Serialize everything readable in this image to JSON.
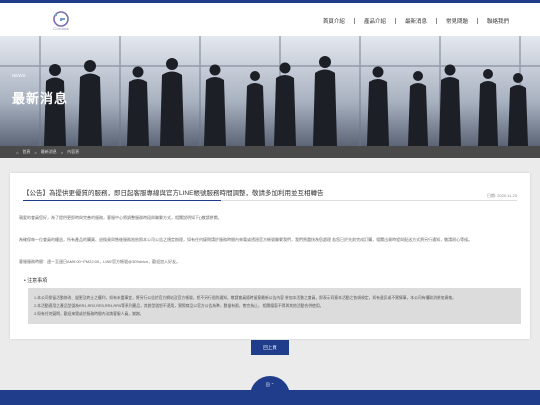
{
  "brand": {
    "logo_text": "Cordina"
  },
  "nav": {
    "items": [
      {
        "label": "首頁介紹"
      },
      {
        "label": "產品介紹"
      },
      {
        "label": "最新消息"
      },
      {
        "label": "常見問題"
      },
      {
        "label": "聯絡我們"
      }
    ]
  },
  "banner": {
    "subtitle": "NEWS",
    "title": "最新消息"
  },
  "breadcrumb": {
    "home": "首頁",
    "sep1": ">",
    "section": "最新消息",
    "sep2": ">",
    "current": "內容頁"
  },
  "article": {
    "title": "【公告】為提供更優質的服務，即日起客服專線與官方LINE帳號服務時間調整，敬請多加利用並互相轉告",
    "date_label": "日期:",
    "date": "2020.11.23",
    "paragraphs": [
      "親愛的會員您好，為了提供更即時與完善的服務，客服中心將調整服務時段與聯繫方式，相關說明如下()敬請參閱。",
      "為確保每一位會員的權益，所有產品的購買、退換貨與售後服務皆依照本公司公告之規定辦理，如有任何疑問請於服務時間內來電或透過官方帳號聯繫我們，我們將盡快為您處理 若您已於先前完成訂購，相關出貨時程與配送方式將另行通知，敬請耐心等候。",
      "客服服務時間：週一至週日AM9:00~PM22:00，LINE官方帳號@309dxlcn，歡迎加入好友。"
    ],
    "notice_title": "注意事項",
    "notices": [
      "1.本公司保留活動修改、變更及終止之權利，如有未盡事宜，將另行公告於官方網站及官方帳號，恕不另行個別通知，敬請會員隨時留意最新公告內容 參加本活動之會員，即表示同意本活動之各項規定，如有違反或不實情事，本公司有權取消參加資格。",
      "2.本活動適用之產品型號為RR1,RR2,RR3,RR4,RR5等系列產品，其餘型號恕不適用，實際商品以官方公告為準，數量有限，售完為止。 相關優惠不得與其他活動合併使用。",
      "3.如有任何疑問，歡迎來電或於服務時間內洽詢客服人員，謝謝。"
    ]
  },
  "back_button": {
    "label": "回上頁"
  },
  "footer": {
    "tab_label": "回 ⌃"
  },
  "colors": {
    "primary": "#1f3d8a",
    "background": "#ebebeb",
    "card": "#ffffff",
    "notice_box": "#dcdcdc"
  },
  "icons": {
    "bullet": "dot-icon",
    "logo": "logo-g-icon"
  }
}
